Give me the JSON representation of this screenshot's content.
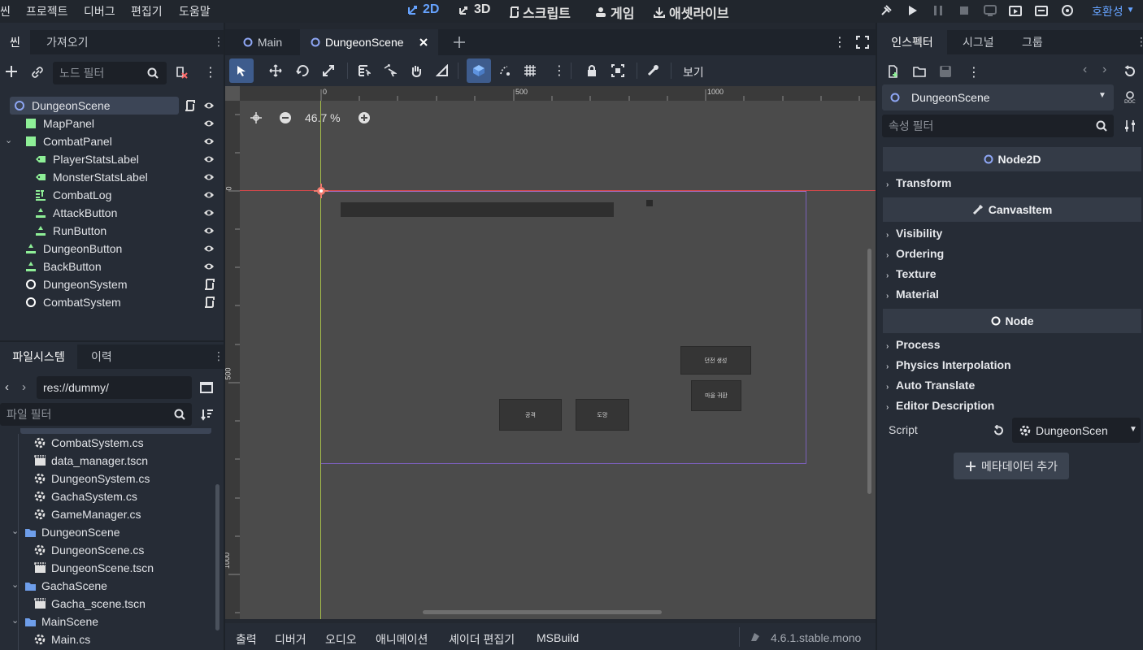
{
  "menu": [
    "씬",
    "프로젝트",
    "디버그",
    "편집기",
    "도움말"
  ],
  "workspaces": [
    {
      "label": "2D",
      "active": true
    },
    {
      "label": "3D",
      "active": false
    },
    {
      "label": "스크립트",
      "active": false
    },
    {
      "label": "게임",
      "active": false
    },
    {
      "label": "애셋라이브",
      "active": false
    }
  ],
  "renderer": "호환성",
  "scene_dock": {
    "tabs": [
      "씬",
      "가져오기"
    ],
    "filter_placeholder": "노드 필터",
    "nodes": [
      {
        "name": "DungeonScene",
        "icon": "node2d-icon"
      },
      {
        "name": "MapPanel",
        "icon": "panel-icon"
      },
      {
        "name": "CombatPanel",
        "icon": "panel-icon"
      },
      {
        "name": "PlayerStatsLabel",
        "icon": "label-icon"
      },
      {
        "name": "MonsterStatsLabel",
        "icon": "label-icon"
      },
      {
        "name": "CombatLog",
        "icon": "richtext-icon"
      },
      {
        "name": "AttackButton",
        "icon": "button-icon"
      },
      {
        "name": "RunButton",
        "icon": "button-icon"
      },
      {
        "name": "DungeonButton",
        "icon": "button-icon"
      },
      {
        "name": "BackButton",
        "icon": "button-icon"
      },
      {
        "name": "DungeonSystem",
        "icon": "node-icon"
      },
      {
        "name": "CombatSystem",
        "icon": "node-icon"
      }
    ]
  },
  "filesystem": {
    "tabs": [
      "파일시스템",
      "이력"
    ],
    "path": "res://dummy/",
    "filter_placeholder": "파일 필터",
    "items": [
      {
        "name": "CombatSystem.cs",
        "type": "cs"
      },
      {
        "name": "data_manager.tscn",
        "type": "scene"
      },
      {
        "name": "DungeonSystem.cs",
        "type": "cs"
      },
      {
        "name": "GachaSystem.cs",
        "type": "cs"
      },
      {
        "name": "GameManager.cs",
        "type": "cs"
      },
      {
        "name": "DungeonScene",
        "type": "folder"
      },
      {
        "name": "DungeonScene.cs",
        "type": "cs"
      },
      {
        "name": "DungeonScene.tscn",
        "type": "scene"
      },
      {
        "name": "GachaScene",
        "type": "folder"
      },
      {
        "name": "Gacha_scene.tscn",
        "type": "scene"
      },
      {
        "name": "MainScene",
        "type": "folder"
      },
      {
        "name": "Main.cs",
        "type": "cs"
      }
    ]
  },
  "editor_tabs": [
    "Main",
    "DungeonScene"
  ],
  "toolbar": {
    "view_label": "보기"
  },
  "viewport": {
    "zoom": "46.7 %",
    "ruler_h": [
      "0",
      "500",
      "1000"
    ],
    "ruler_v": [
      "0",
      "500",
      "1000"
    ],
    "buttons": {
      "attack": "공격",
      "run": "도망",
      "dungeon": "던전 생성",
      "back": "마을 귀환"
    }
  },
  "bottom_tabs": [
    "출력",
    "디버거",
    "오디오",
    "애니메이션",
    "셰이더 편집기",
    "MSBuild"
  ],
  "version": "4.6.1.stable.mono",
  "inspector": {
    "tabs": [
      "인스펙터",
      "시그널",
      "그룹"
    ],
    "selected_node": "DungeonScene",
    "filter_placeholder": "속성 필터",
    "sections": [
      {
        "title": "Node2D",
        "props": [
          "Transform"
        ]
      },
      {
        "title": "CanvasItem",
        "props": [
          "Visibility",
          "Ordering",
          "Texture",
          "Material"
        ]
      },
      {
        "title": "Node",
        "props": [
          "Process",
          "Physics Interpolation",
          "Auto Translate",
          "Editor Description"
        ]
      }
    ],
    "script_label": "Script",
    "script_value": "DungeonScen",
    "add_metadata": "메타데이터 추가"
  },
  "colors": {
    "accent": "#66a3ff",
    "node": "#8ea6f4",
    "control": "#8eef97",
    "panel_bg": "#262c36"
  }
}
